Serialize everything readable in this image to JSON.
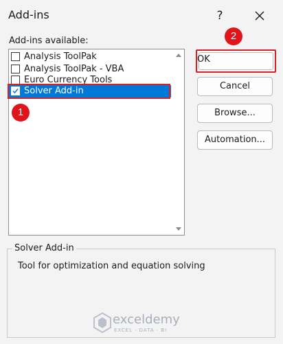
{
  "dialog": {
    "title": "Add-ins",
    "help_symbol": "?",
    "available_label": "Add-ins available:",
    "items": [
      {
        "label": "Analysis ToolPak",
        "checked": false
      },
      {
        "label": "Analysis ToolPak - VBA",
        "checked": false
      },
      {
        "label": "Euro Currency Tools",
        "checked": false
      },
      {
        "label": "Solver Add-in",
        "checked": true,
        "selected": true
      }
    ],
    "buttons": {
      "ok": "OK",
      "cancel": "Cancel",
      "browse": "Browse...",
      "automation": "Automation..."
    },
    "group_title": "Solver Add-in",
    "description": "Tool for optimization and equation solving"
  },
  "annotations": {
    "step1": "1",
    "step2": "2"
  },
  "watermark": {
    "name": "exceldemy",
    "tagline": "EXCEL · DATA · BI"
  },
  "colors": {
    "selection": "#0078d7",
    "highlight": "#d71f26",
    "badge": "#e0141b"
  }
}
